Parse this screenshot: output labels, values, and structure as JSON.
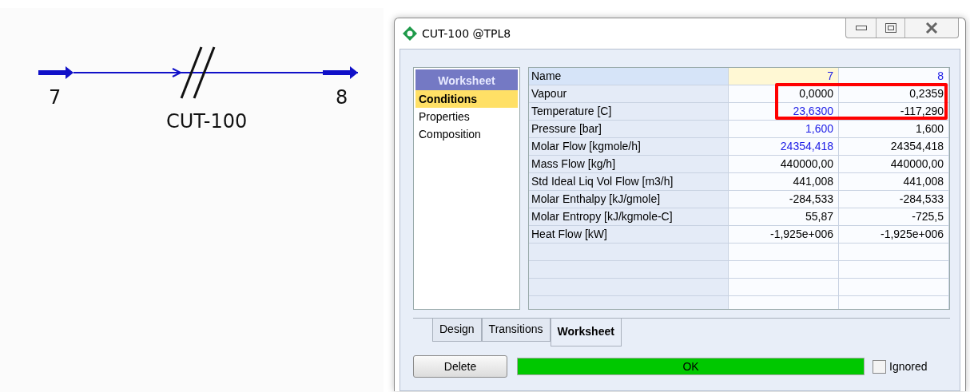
{
  "diagram": {
    "inlet": "7",
    "outlet": "8",
    "unit": "CUT-100"
  },
  "window": {
    "title": "CUT-100 @TPL8"
  },
  "nav": {
    "header": "Worksheet",
    "items": [
      {
        "label": "Conditions",
        "selected": true
      },
      {
        "label": "Properties",
        "selected": false
      },
      {
        "label": "Composition",
        "selected": false
      }
    ]
  },
  "table": {
    "rows": [
      {
        "label": "Name",
        "selected": true,
        "cells": [
          {
            "value": "7",
            "specified": true,
            "selected": true
          },
          {
            "value": "8",
            "specified": true,
            "selected": false
          }
        ]
      },
      {
        "label": "Vapour",
        "selected": false,
        "cells": [
          {
            "value": "0,0000",
            "specified": false,
            "selected": false
          },
          {
            "value": "0,2359",
            "specified": false,
            "selected": false
          }
        ]
      },
      {
        "label": "Temperature [C]",
        "selected": false,
        "cells": [
          {
            "value": "23,6300",
            "specified": true,
            "selected": false
          },
          {
            "value": "-117,290",
            "specified": false,
            "selected": false
          }
        ]
      },
      {
        "label": "Pressure [bar]",
        "selected": false,
        "cells": [
          {
            "value": "1,600",
            "specified": true,
            "selected": false
          },
          {
            "value": "1,600",
            "specified": false,
            "selected": false
          }
        ]
      },
      {
        "label": "Molar Flow [kgmole/h]",
        "selected": false,
        "cells": [
          {
            "value": "24354,418",
            "specified": true,
            "selected": false
          },
          {
            "value": "24354,418",
            "specified": false,
            "selected": false
          }
        ]
      },
      {
        "label": "Mass Flow [kg/h]",
        "selected": false,
        "cells": [
          {
            "value": "440000,00",
            "specified": false,
            "selected": false
          },
          {
            "value": "440000,00",
            "specified": false,
            "selected": false
          }
        ]
      },
      {
        "label": "Std Ideal Liq Vol Flow [m3/h]",
        "selected": false,
        "cells": [
          {
            "value": "441,008",
            "specified": false,
            "selected": false
          },
          {
            "value": "441,008",
            "specified": false,
            "selected": false
          }
        ]
      },
      {
        "label": "Molar Enthalpy [kJ/gmole]",
        "selected": false,
        "cells": [
          {
            "value": "-284,533",
            "specified": false,
            "selected": false
          },
          {
            "value": "-284,533",
            "specified": false,
            "selected": false
          }
        ]
      },
      {
        "label": "Molar Entropy [kJ/kgmole-C]",
        "selected": false,
        "cells": [
          {
            "value": "55,87",
            "specified": false,
            "selected": false
          },
          {
            "value": "-725,5",
            "specified": false,
            "selected": false
          }
        ]
      },
      {
        "label": "Heat Flow [kW]",
        "selected": false,
        "cells": [
          {
            "value": "-1,925e+006",
            "specified": false,
            "selected": false
          },
          {
            "value": "-1,925e+006",
            "specified": false,
            "selected": false
          }
        ]
      }
    ]
  },
  "tabs": [
    {
      "label": "Design",
      "selected": false
    },
    {
      "label": "Transitions",
      "selected": false
    },
    {
      "label": "Worksheet",
      "selected": true
    }
  ],
  "buttons": {
    "delete": "Delete"
  },
  "status": {
    "text": "OK",
    "color": "#00c800"
  },
  "ignored": {
    "label": "Ignored",
    "checked": false
  }
}
